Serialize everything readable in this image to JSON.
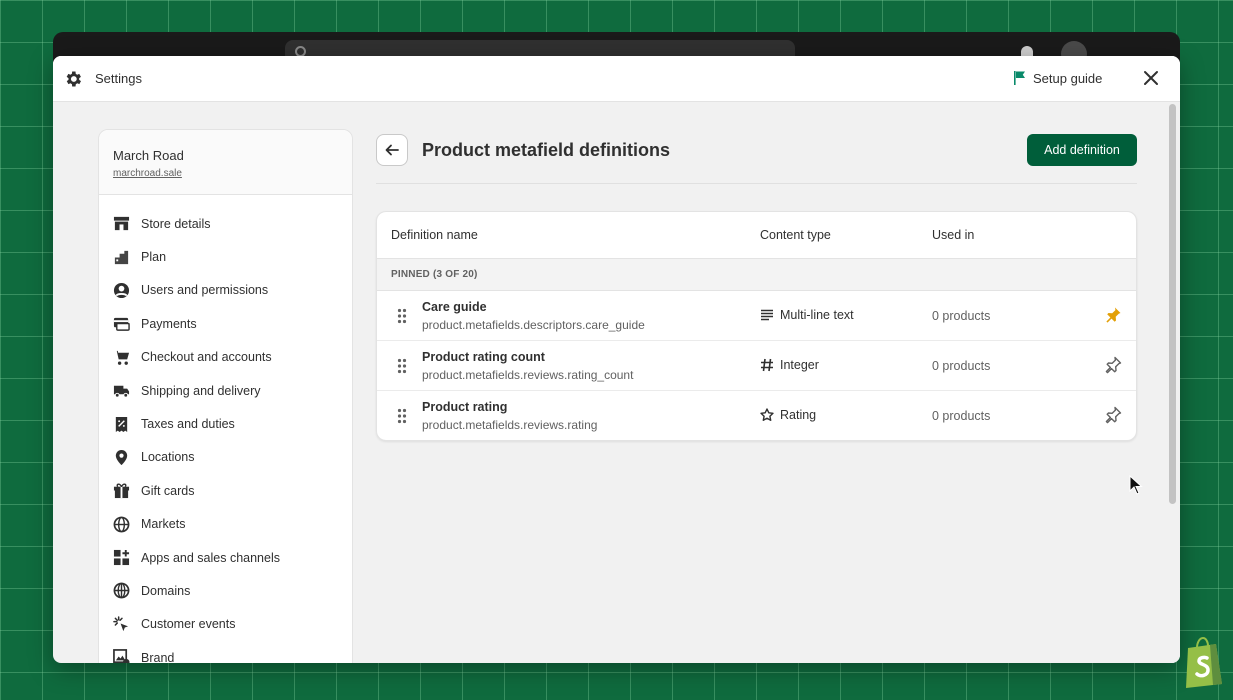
{
  "modal": {
    "title": "Settings",
    "setup_guide": "Setup guide"
  },
  "store": {
    "name": "March Road",
    "url": "marchroad.sale"
  },
  "sidebar": {
    "items": [
      {
        "label": "Store details",
        "icon": "store-icon"
      },
      {
        "label": "Plan",
        "icon": "plan-icon"
      },
      {
        "label": "Users and permissions",
        "icon": "user-icon"
      },
      {
        "label": "Payments",
        "icon": "payments-icon"
      },
      {
        "label": "Checkout and accounts",
        "icon": "cart-icon"
      },
      {
        "label": "Shipping and delivery",
        "icon": "truck-icon"
      },
      {
        "label": "Taxes and duties",
        "icon": "receipt-icon"
      },
      {
        "label": "Locations",
        "icon": "location-icon"
      },
      {
        "label": "Gift cards",
        "icon": "gift-icon"
      },
      {
        "label": "Markets",
        "icon": "globe-icon"
      },
      {
        "label": "Apps and sales channels",
        "icon": "apps-icon"
      },
      {
        "label": "Domains",
        "icon": "domains-icon"
      },
      {
        "label": "Customer events",
        "icon": "cursor-click-icon"
      },
      {
        "label": "Brand",
        "icon": "brand-icon"
      }
    ]
  },
  "page": {
    "title": "Product metafield definitions",
    "add_button": "Add definition"
  },
  "table": {
    "headers": {
      "name": "Definition name",
      "content_type": "Content type",
      "used_in": "Used in"
    },
    "pinned_label": "PINNED (3 OF 20)",
    "rows": [
      {
        "name": "Care guide",
        "key": "product.metafields.descriptors.care_guide",
        "content_type": "Multi-line text",
        "type_icon": "text-lines-icon",
        "used_in": "0 products",
        "pinned": true
      },
      {
        "name": "Product rating count",
        "key": "product.metafields.reviews.rating_count",
        "content_type": "Integer",
        "type_icon": "hash-icon",
        "used_in": "0 products",
        "pinned": false
      },
      {
        "name": "Product rating",
        "key": "product.metafields.reviews.rating",
        "content_type": "Rating",
        "type_icon": "star-icon",
        "used_in": "0 products",
        "pinned": false
      }
    ]
  },
  "colors": {
    "primary_button": "#005e3a",
    "pin_active": "#e3a008",
    "background": "#0f6b3e"
  }
}
